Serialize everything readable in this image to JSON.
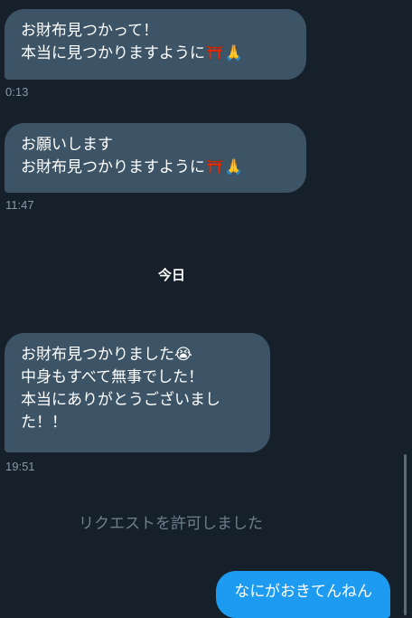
{
  "messages": [
    {
      "lines": [
        "お財布見つかって！",
        "本当に見つかりますように⛩️🙏"
      ],
      "time": "0:13"
    },
    {
      "lines": [
        "お願いします",
        "お財布見つかりますように⛩️🙏"
      ],
      "time": "11:47"
    },
    {
      "lines": [
        "お財布見つかりました😭",
        "中身もすべて無事でした！",
        "本当にありがとうございまし",
        "た！！"
      ],
      "time": "19:51"
    }
  ],
  "day_divider": "今日",
  "system_notice": "リクエストを許可しました",
  "outgoing": {
    "text": "なにがおきてんねん"
  },
  "colors": {
    "background": "#15202b",
    "incoming_bubble": "#3d5466",
    "outgoing_bubble": "#1d9bf0",
    "timestamp": "#8899a6"
  }
}
